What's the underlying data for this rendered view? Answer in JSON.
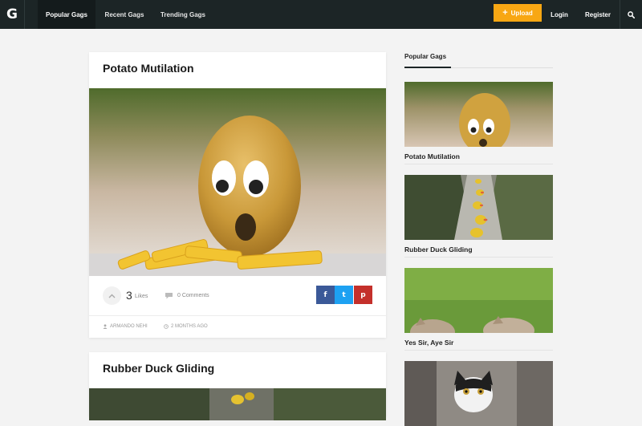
{
  "header": {
    "logo_text": "G",
    "nav": [
      {
        "label": "Popular Gags",
        "active": true
      },
      {
        "label": "Recent Gags",
        "active": false
      },
      {
        "label": "Trending Gags",
        "active": false
      }
    ],
    "upload_label": "Upload",
    "login_label": "Login",
    "register_label": "Register",
    "accent_color": "#f8a713",
    "bar_color": "#1c2526"
  },
  "posts": [
    {
      "title": "Potato Mutilation",
      "likes": "3",
      "likes_label": "Likes",
      "comments": "0 Comments",
      "author": "ARMANDO NEHI",
      "time": "2 MONTHS AGO",
      "share": {
        "facebook": "f",
        "twitter": "t",
        "pinterest": "p"
      }
    },
    {
      "title": "Rubber Duck Gliding"
    }
  ],
  "sidebar": {
    "heading": "Popular Gags",
    "items": [
      {
        "title": "Potato Mutilation",
        "icon": "potato-thumbnail"
      },
      {
        "title": "Rubber Duck Gliding",
        "icon": "duck-thumbnail"
      },
      {
        "title": "Yes Sir, Aye Sir",
        "icon": "cats-thumbnail"
      },
      {
        "title": "",
        "icon": "cat-thumbnail"
      }
    ]
  }
}
